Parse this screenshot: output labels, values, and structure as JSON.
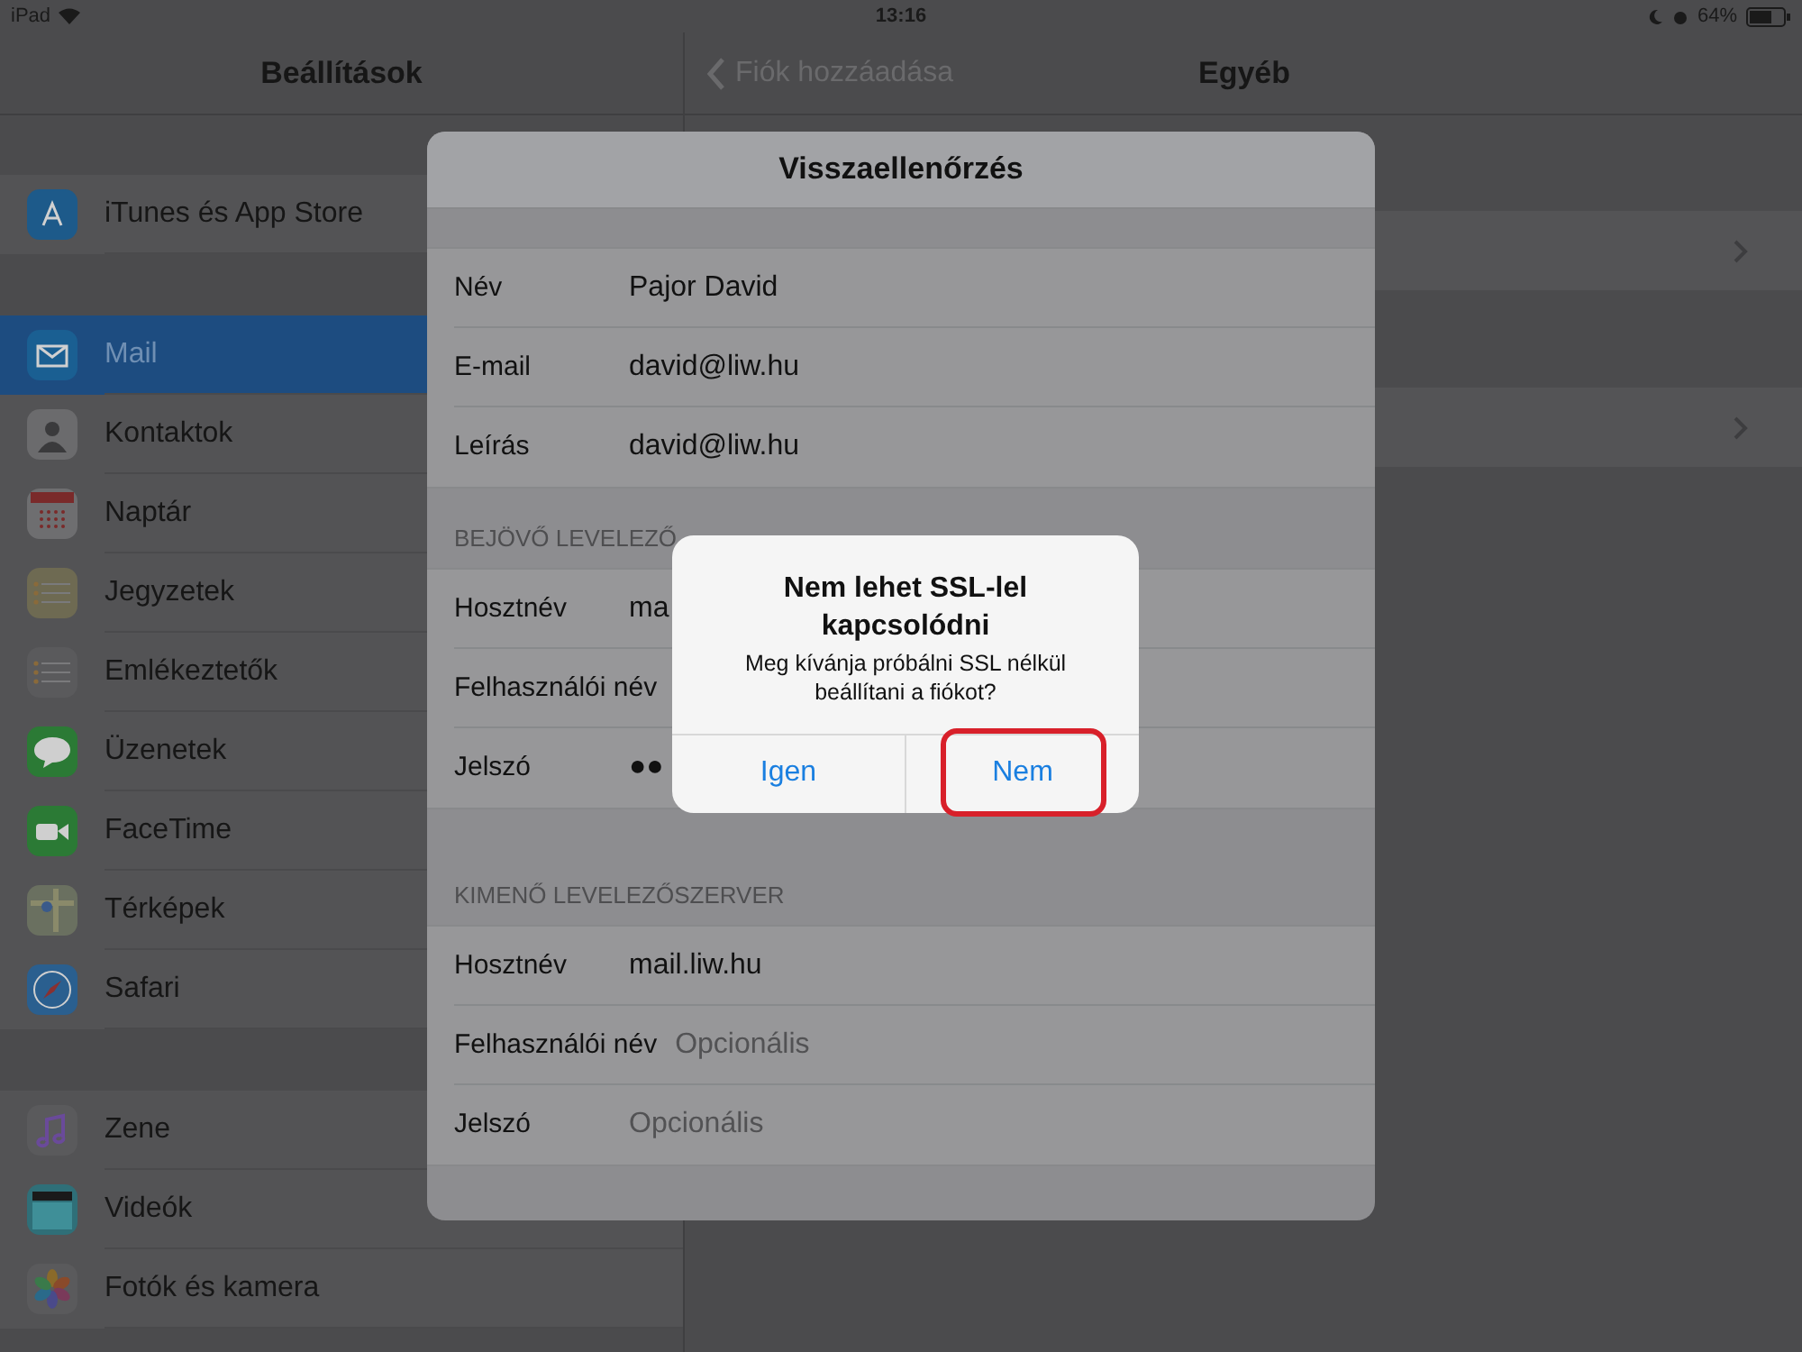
{
  "status_bar": {
    "device": "iPad",
    "time": "13:16",
    "battery": "64%"
  },
  "sidebar": {
    "title": "Beállítások",
    "groups": [
      [
        {
          "label": "iTunes és App Store",
          "kind": "appstore",
          "selected": false
        }
      ],
      [
        {
          "label": "Mail",
          "kind": "mail",
          "selected": true
        },
        {
          "label": "Kontaktok",
          "kind": "contacts",
          "selected": false
        },
        {
          "label": "Naptár",
          "kind": "calendar",
          "selected": false
        },
        {
          "label": "Jegyzetek",
          "kind": "notes",
          "selected": false
        },
        {
          "label": "Emlékeztetők",
          "kind": "reminders",
          "selected": false
        },
        {
          "label": "Üzenetek",
          "kind": "messages",
          "selected": false
        },
        {
          "label": "FaceTime",
          "kind": "facetime",
          "selected": false
        },
        {
          "label": "Térképek",
          "kind": "maps",
          "selected": false
        },
        {
          "label": "Safari",
          "kind": "safari",
          "selected": false
        }
      ],
      [
        {
          "label": "Zene",
          "kind": "music",
          "selected": false
        },
        {
          "label": "Videók",
          "kind": "videos",
          "selected": false
        },
        {
          "label": "Fotók és kamera",
          "kind": "photos",
          "selected": false
        }
      ]
    ]
  },
  "detail": {
    "back": "Fiók hozzáadása",
    "title": "Egyéb"
  },
  "sheet": {
    "title": "Visszaellenőrzés",
    "account_rows": [
      {
        "label": "Név",
        "value": "Pajor David"
      },
      {
        "label": "E-mail",
        "value": "david@liw.hu"
      },
      {
        "label": "Leírás",
        "value": "david@liw.hu"
      }
    ],
    "incoming": {
      "header": "BEJÖVŐ LEVELEZŐ",
      "rows": [
        {
          "label": "Hosztnév",
          "value": "ma"
        },
        {
          "label": "Felhasználói név"
        },
        {
          "label": "Jelszó",
          "value": "●●"
        }
      ]
    },
    "outgoing": {
      "header": "KIMENŐ LEVELEZŐSZERVER",
      "rows": [
        {
          "label": "Hosztnév",
          "value": "mail.liw.hu"
        },
        {
          "label": "Felhasználói név",
          "placeholder": "Opcionális"
        },
        {
          "label": "Jelszó",
          "placeholder": "Opcionális"
        }
      ]
    }
  },
  "alert": {
    "title": "Nem lehet SSL-lel kapcsolódni",
    "message": "Meg kívánja próbálni SSL nélkül beállítani a fiókot?",
    "buttons": [
      {
        "label": "Igen",
        "highlighted": false
      },
      {
        "label": "Nem",
        "highlighted": true
      }
    ]
  }
}
